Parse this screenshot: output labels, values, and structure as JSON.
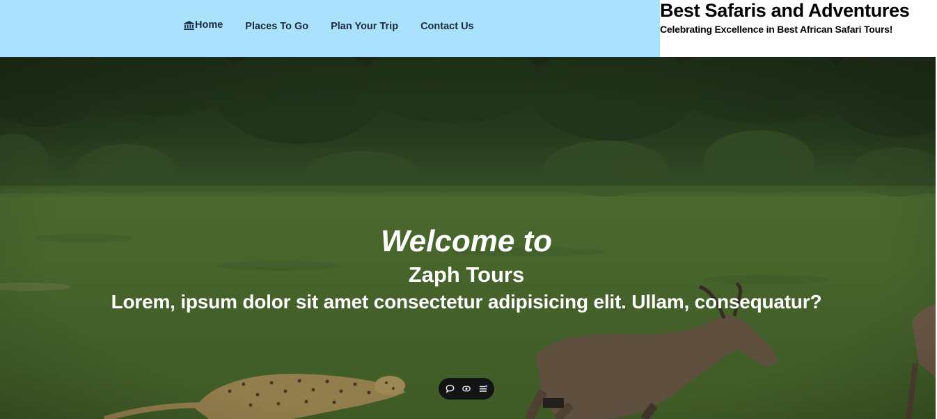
{
  "nav": {
    "items": [
      {
        "label": "Home",
        "icon": "bank-icon"
      },
      {
        "label": "Places To Go"
      },
      {
        "label": "Plan Your Trip"
      },
      {
        "label": "Contact Us"
      }
    ],
    "background": "#aae2fe",
    "text_color": "#1b2a3d"
  },
  "brand": {
    "title": "Best Safaris and Adventures",
    "subtitle": "Celebrating Excellence in Best African Safari Tours!"
  },
  "hero": {
    "welcome": "Welcome to",
    "company": "Zaph Tours",
    "tagline": "Lorem, ipsum dolor sit amet consectetur adipisicing elit. Ullam, consequatur?",
    "image_alt": "cheetah chasing antelopes on a savanna"
  },
  "toolbar": {
    "buttons": [
      {
        "icon": "comment-icon"
      },
      {
        "icon": "eye-icon"
      },
      {
        "icon": "menu-icon"
      }
    ]
  }
}
